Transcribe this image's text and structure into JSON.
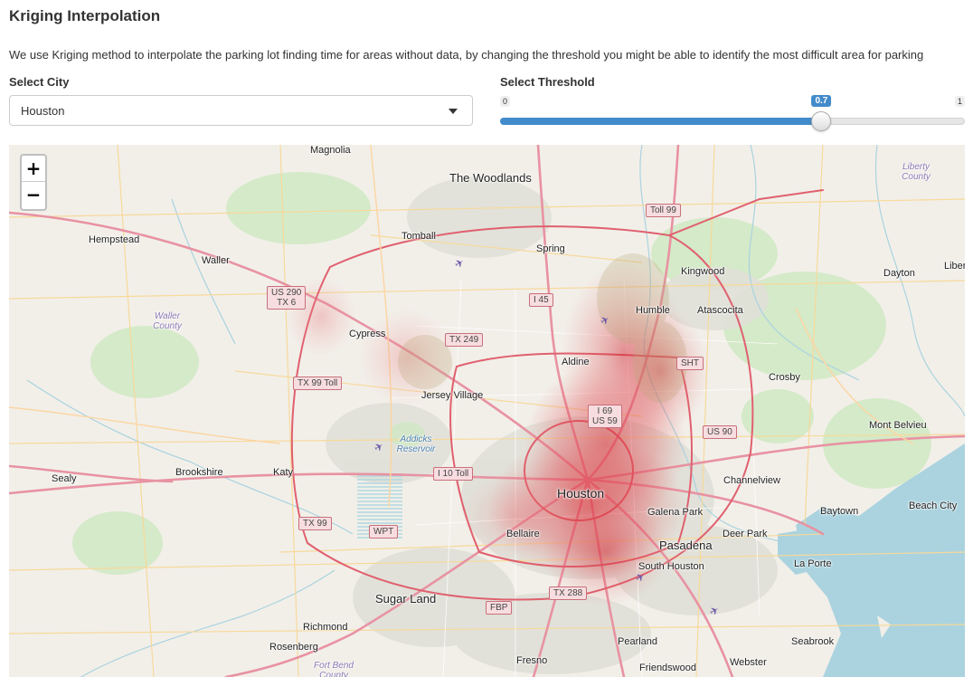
{
  "header": {
    "title": "Kriging Interpolation",
    "description": "We use Kriging method to interpolate the parking lot finding time for areas without data, by changing the threshold you might be able to identify the most difficult area for parking"
  },
  "city_select": {
    "label": "Select City",
    "value": "Houston"
  },
  "threshold_slider": {
    "label": "Select Threshold",
    "min": "0",
    "max": "1",
    "value": "0.7",
    "fraction": 0.7
  },
  "map": {
    "zoom_in_label": "+",
    "zoom_out_label": "−",
    "places": {
      "magnolia": "Magnolia",
      "the_woodlands": "The Woodlands",
      "hempstead": "Hempstead",
      "waller": "Waller",
      "tomball": "Tomball",
      "spring": "Spring",
      "kingwood": "Kingwood",
      "dayton": "Dayton",
      "liberty_county": "Liberty County",
      "libe": "Liber",
      "humble": "Humble",
      "atascocita": "Atascocita",
      "waller_county": "Waller County",
      "cypress": "Cypress",
      "aldine": "Aldine",
      "crosby": "Crosby",
      "jersey_village": "Jersey Village",
      "mont_belvieu": "Mont Belvieu",
      "addicks_reservoir": "Addicks Reservoir",
      "sealy": "Sealy",
      "brookshire": "Brookshire",
      "katy": "Katy",
      "channelview": "Channelview",
      "houston": "Houston",
      "galena_park": "Galena Park",
      "baytown": "Baytown",
      "beach_city": "Beach City",
      "bellaire": "Bellaire",
      "deer_park": "Deer Park",
      "pasadena": "Pasadena",
      "south_houston": "South Houston",
      "la_porte": "La Porte",
      "sugar_land": "Sugar Land",
      "richmond": "Richmond",
      "rosenberg": "Rosenberg",
      "fresno": "Fresno",
      "pearland": "Pearland",
      "seabrook": "Seabrook",
      "webster": "Webster",
      "friendswood": "Friendswood",
      "fort_bend_county": "Fort Bend County"
    },
    "shields": {
      "toll99": "Toll 99",
      "us290": "US 290",
      "tx6": "TX 6",
      "i45": "I 45",
      "tx249": "TX 249",
      "sht": "SHT",
      "tx99toll": "TX 99 Toll",
      "i69": "I 69",
      "us59": "US 59",
      "us90": "US 90",
      "i10toll": "I 10 Toll",
      "tx99": "TX 99",
      "wpt": "WPT",
      "tx288": "TX 288",
      "fbp": "FBP"
    },
    "colors": {
      "land": "#f2efe9",
      "water": "#aad3df",
      "motorway": "#e892a2",
      "primary": "#fcd6a4",
      "heat": "#d9252f"
    }
  }
}
